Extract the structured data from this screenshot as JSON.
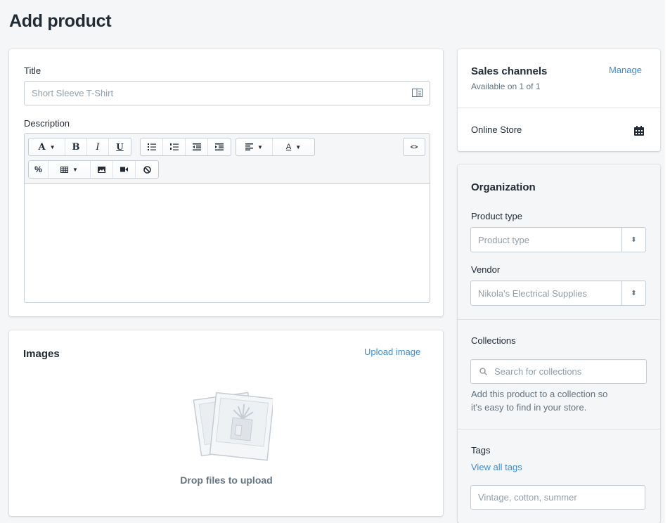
{
  "page": {
    "title": "Add product"
  },
  "product": {
    "title_label": "Title",
    "title_placeholder": "Short Sleeve T-Shirt",
    "description_label": "Description"
  },
  "editor": {
    "toolbar_row1": [
      "A",
      "B",
      "I",
      "U",
      "bullet-list",
      "numbered-list",
      "outdent",
      "indent",
      "align",
      "text-color",
      "html"
    ],
    "toolbar_row2": [
      "link",
      "table",
      "image",
      "video",
      "clear-formatting"
    ],
    "font_glyph": "A",
    "bold_glyph": "B",
    "italic_glyph": "I",
    "underline_glyph": "U",
    "color_glyph": "A"
  },
  "images": {
    "heading": "Images",
    "upload_link": "Upload image",
    "drop_text": "Drop files to upload"
  },
  "sales_channels": {
    "heading": "Sales channels",
    "manage_link": "Manage",
    "availability": "Available on 1 of 1",
    "channel_name": "Online Store"
  },
  "organization": {
    "heading": "Organization",
    "product_type_label": "Product type",
    "product_type_placeholder": "Product type",
    "vendor_label": "Vendor",
    "vendor_placeholder": "Nikola's Electrical Supplies",
    "collections_label": "Collections",
    "collections_placeholder": "Search for collections",
    "collections_help_line1": "Add this product to a collection so",
    "collections_help_line2": "it's easy to find in your store.",
    "tags_label": "Tags",
    "view_all_tags_link": "View all tags",
    "tags_placeholder": "Vintage, cotton, summer"
  },
  "colors": {
    "accent": "#3e8ed0",
    "background": "#f4f6f8",
    "text": "#212b36",
    "muted": "#637381",
    "border": "#c4cdd5"
  }
}
